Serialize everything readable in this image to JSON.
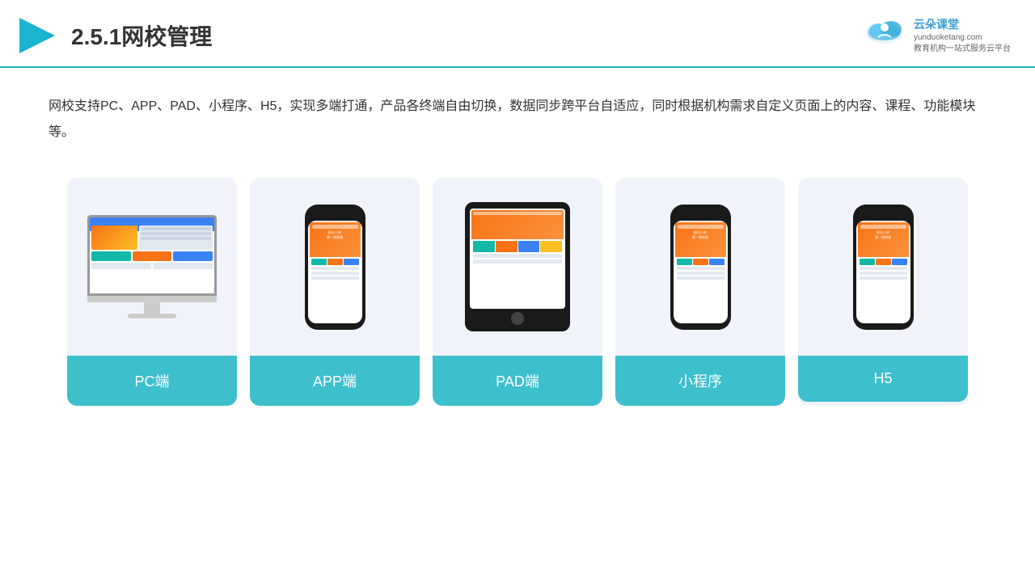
{
  "header": {
    "title": "2.5.1网校管理",
    "logo_brand": "云朵课堂",
    "logo_url": "yunduoketang.com",
    "logo_tagline": "教育机构一站\n式服务云平台"
  },
  "description": {
    "text": "网校支持PC、APP、PAD、小程序、H5，实现多端打通，产品各终端自由切换，数据同步跨平台自适应，同时根据机构需求自定义页面上的内容、课程、功能模块等。"
  },
  "cards": [
    {
      "id": "pc",
      "label": "PC端"
    },
    {
      "id": "app",
      "label": "APP端"
    },
    {
      "id": "pad",
      "label": "PAD端"
    },
    {
      "id": "miniprogram",
      "label": "小程序"
    },
    {
      "id": "h5",
      "label": "H5"
    }
  ],
  "accent_color": "#3dbfcc"
}
